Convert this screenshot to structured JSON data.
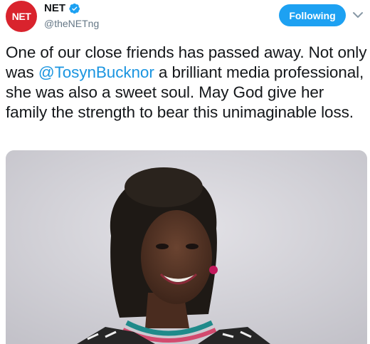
{
  "account": {
    "avatar_text": "NET",
    "display_name": "NET",
    "handle": "@theNETng",
    "verified": true
  },
  "actions": {
    "follow_label": "Following",
    "more_icon": "chevron-down-icon"
  },
  "tweet": {
    "text_before": "One of our close friends has passed away. Not only was ",
    "mention": "@TosynBucknor",
    "text_after": " a brilliant media professional, she was also a sweet soul. May God give her family the strength to bear this unimaginable loss."
  },
  "media": {
    "type": "photo"
  },
  "colors": {
    "accent": "#1da1f2",
    "mention": "#1b95e0",
    "brand": "#d9232d"
  }
}
